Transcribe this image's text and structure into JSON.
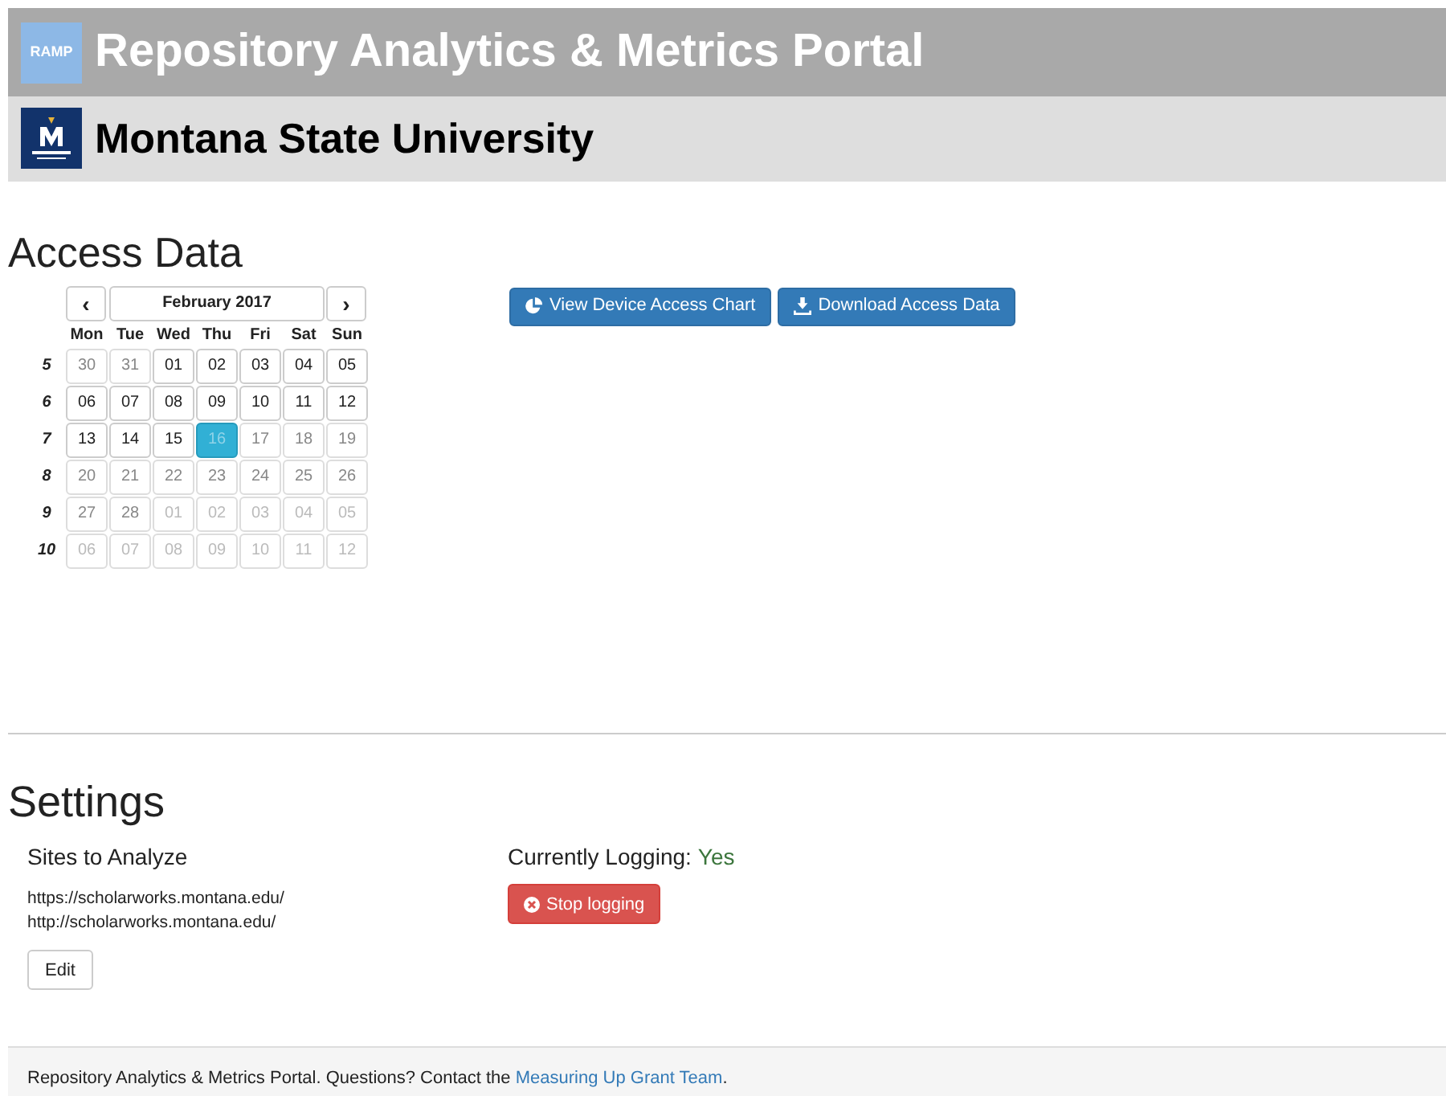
{
  "header": {
    "logo_text": "RAMP",
    "title": "Repository Analytics & Metrics Portal"
  },
  "institution": {
    "name": "Montana State University"
  },
  "access": {
    "heading": "Access Data",
    "calendar": {
      "prev": "‹",
      "month": "February 2017",
      "next": "›",
      "weekdays": [
        "Mon",
        "Tue",
        "Wed",
        "Thu",
        "Fri",
        "Sat",
        "Sun"
      ],
      "weeks": [
        {
          "week": "5",
          "days": [
            {
              "text": "30",
              "kind": "disabled",
              "selected": false
            },
            {
              "text": "31",
              "kind": "disabled",
              "selected": false
            },
            {
              "text": "01",
              "kind": "enabled",
              "selected": false
            },
            {
              "text": "02",
              "kind": "enabled",
              "selected": false
            },
            {
              "text": "03",
              "kind": "enabled",
              "selected": false
            },
            {
              "text": "04",
              "kind": "enabled",
              "selected": false
            },
            {
              "text": "05",
              "kind": "enabled",
              "selected": false
            }
          ]
        },
        {
          "week": "6",
          "days": [
            {
              "text": "06",
              "kind": "enabled",
              "selected": false
            },
            {
              "text": "07",
              "kind": "enabled",
              "selected": false
            },
            {
              "text": "08",
              "kind": "enabled",
              "selected": false
            },
            {
              "text": "09",
              "kind": "enabled",
              "selected": false
            },
            {
              "text": "10",
              "kind": "enabled",
              "selected": false
            },
            {
              "text": "11",
              "kind": "enabled",
              "selected": false
            },
            {
              "text": "12",
              "kind": "enabled",
              "selected": false
            }
          ]
        },
        {
          "week": "7",
          "days": [
            {
              "text": "13",
              "kind": "enabled",
              "selected": false
            },
            {
              "text": "14",
              "kind": "enabled",
              "selected": false
            },
            {
              "text": "15",
              "kind": "enabled",
              "selected": false
            },
            {
              "text": "16",
              "kind": "enabled",
              "selected": true
            },
            {
              "text": "17",
              "kind": "disabled",
              "selected": false
            },
            {
              "text": "18",
              "kind": "disabled",
              "selected": false
            },
            {
              "text": "19",
              "kind": "disabled",
              "selected": false
            }
          ]
        },
        {
          "week": "8",
          "days": [
            {
              "text": "20",
              "kind": "disabled",
              "selected": false
            },
            {
              "text": "21",
              "kind": "disabled",
              "selected": false
            },
            {
              "text": "22",
              "kind": "disabled",
              "selected": false
            },
            {
              "text": "23",
              "kind": "disabled",
              "selected": false
            },
            {
              "text": "24",
              "kind": "disabled",
              "selected": false
            },
            {
              "text": "25",
              "kind": "disabled",
              "selected": false
            },
            {
              "text": "26",
              "kind": "disabled",
              "selected": false
            }
          ]
        },
        {
          "week": "9",
          "days": [
            {
              "text": "27",
              "kind": "disabled",
              "selected": false
            },
            {
              "text": "28",
              "kind": "disabled",
              "selected": false
            },
            {
              "text": "01",
              "kind": "other_month",
              "selected": false
            },
            {
              "text": "02",
              "kind": "other_month",
              "selected": false
            },
            {
              "text": "03",
              "kind": "other_month",
              "selected": false
            },
            {
              "text": "04",
              "kind": "other_month",
              "selected": false
            },
            {
              "text": "05",
              "kind": "other_month",
              "selected": false
            }
          ]
        },
        {
          "week": "10",
          "days": [
            {
              "text": "06",
              "kind": "other_month",
              "selected": false
            },
            {
              "text": "07",
              "kind": "other_month",
              "selected": false
            },
            {
              "text": "08",
              "kind": "other_month",
              "selected": false
            },
            {
              "text": "09",
              "kind": "other_month",
              "selected": false
            },
            {
              "text": "10",
              "kind": "other_month",
              "selected": false
            },
            {
              "text": "11",
              "kind": "other_month",
              "selected": false
            },
            {
              "text": "12",
              "kind": "other_month",
              "selected": false
            }
          ]
        }
      ]
    },
    "buttons": [
      {
        "kind": "chart",
        "label": "View Device Access Chart"
      },
      {
        "kind": "download",
        "label": "Download Access Data"
      }
    ]
  },
  "settings": {
    "heading": "Settings",
    "sites_heading": "Sites to Analyze",
    "sites": [
      "https://scholarworks.montana.edu/",
      "http://scholarworks.montana.edu/"
    ],
    "edit": "Edit",
    "logging_label": "Currently Logging:",
    "logging_value": "Yes",
    "logging_on": true,
    "stop": "Stop logging"
  },
  "footer": {
    "text": "Repository Analytics & Metrics Portal. Questions? Contact the",
    "link": "Measuring Up Grant Team",
    "end": "."
  }
}
